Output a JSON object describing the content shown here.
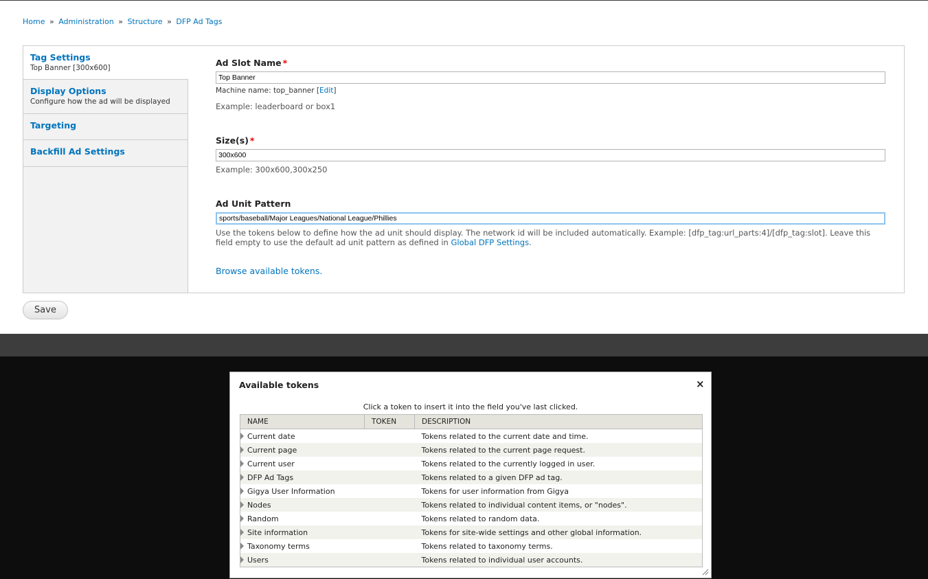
{
  "breadcrumb": [
    "Home",
    "Administration",
    "Structure",
    "DFP Ad Tags"
  ],
  "breadcrumb_sep": "»",
  "tabs": [
    {
      "title": "Tag Settings",
      "summary": "Top Banner [300x600]"
    },
    {
      "title": "Display Options",
      "summary": "Configure how the ad will be displayed"
    },
    {
      "title": "Targeting",
      "summary": ""
    },
    {
      "title": "Backfill Ad Settings",
      "summary": ""
    }
  ],
  "form": {
    "slot_name": {
      "label": "Ad Slot Name",
      "required": "*",
      "value": "Top Banner",
      "machine_prefix": "Machine name: top_banner [",
      "machine_edit": "Edit",
      "machine_suffix": "]",
      "description": "Example: leaderboard or box1"
    },
    "sizes": {
      "label": "Size(s)",
      "required": "*",
      "value": "300x600",
      "description": "Example: 300x600,300x250"
    },
    "ad_unit": {
      "label": "Ad Unit Pattern",
      "value": "sports/baseball/Major Leagues/National League/Phillies",
      "description_line1": "Use the tokens below to define how the ad unit should display. The network id will be included automatically. Example: [dfp_tag:url_parts:4]/[dfp_tag:slot]. Leave this",
      "description_line2": "field empty to use the default ad unit pattern as defined in ",
      "description_link": "Global DFP Settings",
      "description_end": "."
    },
    "browse_link": "Browse available tokens."
  },
  "save_label": "Save",
  "dialog": {
    "title": "Available tokens",
    "close": "×",
    "help": "Click a token to insert it into the field you've last clicked.",
    "columns": [
      "NAME",
      "TOKEN",
      "DESCRIPTION"
    ],
    "rows": [
      {
        "name": "Current date",
        "description": "Tokens related to the current date and time."
      },
      {
        "name": "Current page",
        "description": "Tokens related to the current page request."
      },
      {
        "name": "Current user",
        "description": "Tokens related to the currently logged in user."
      },
      {
        "name": "DFP Ad Tags",
        "description": "Tokens related to a given DFP ad tag."
      },
      {
        "name": "Gigya User Information",
        "description": "Tokens for user information from Gigya"
      },
      {
        "name": "Nodes",
        "description": "Tokens related to individual content items, or \"nodes\"."
      },
      {
        "name": "Random",
        "description": "Tokens related to random data."
      },
      {
        "name": "Site information",
        "description": "Tokens for site-wide settings and other global information."
      },
      {
        "name": "Taxonomy terms",
        "description": "Tokens related to taxonomy terms."
      },
      {
        "name": "Users",
        "description": "Tokens related to individual user accounts."
      }
    ]
  },
  "colors": {
    "link": "#0074bd",
    "required": "#ee0000",
    "overlay": "#0d0d0d"
  }
}
